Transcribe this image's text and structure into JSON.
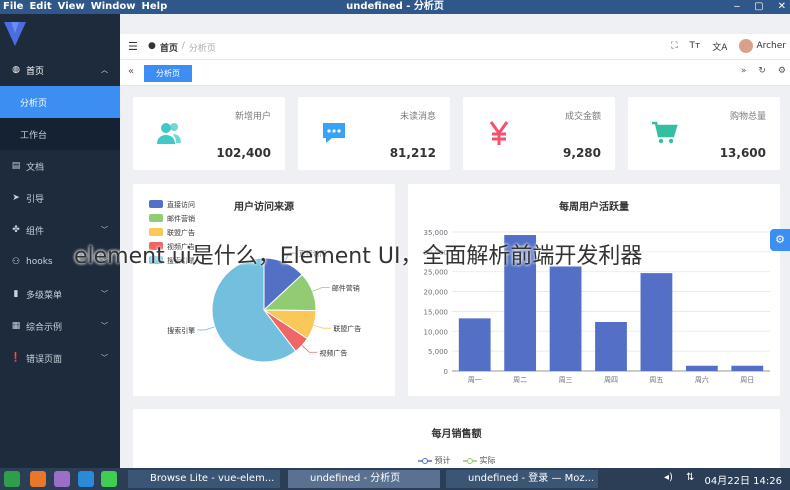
{
  "window": {
    "title": "undefined - 分析页",
    "menus": [
      "File",
      "Edit",
      "View",
      "Window",
      "Help"
    ]
  },
  "sidebar": {
    "items": [
      {
        "label": "首页",
        "icon": "dashboard-icon",
        "expanded": true
      },
      {
        "label": "文档",
        "icon": "document-icon"
      },
      {
        "label": "引导",
        "icon": "send-icon"
      },
      {
        "label": "组件",
        "icon": "component-icon"
      },
      {
        "label": "hooks",
        "icon": "hooks-icon"
      },
      {
        "label": "多级菜单",
        "icon": "chart-icon"
      },
      {
        "label": "综合示例",
        "icon": "book-icon"
      },
      {
        "label": "错误页面",
        "icon": "error-icon"
      }
    ],
    "subitems": [
      "分析页",
      "工作台"
    ]
  },
  "navbar": {
    "breadcrumb_home": "首页",
    "breadcrumb_current": "分析页",
    "user": "Archer"
  },
  "tags": {
    "active": "分析页"
  },
  "stats": [
    {
      "label": "新增用户",
      "value": "102,400",
      "color": "#40c9c6"
    },
    {
      "label": "未读消息",
      "value": "81,212",
      "color": "#36a3f7"
    },
    {
      "label": "成交金额",
      "value": "9,280",
      "color": "#f4516c"
    },
    {
      "label": "购物总量",
      "value": "13,600",
      "color": "#34bfa3"
    }
  ],
  "pie": {
    "title": "用户访问来源",
    "chart_data": {
      "type": "pie",
      "categories": [
        "直接访问",
        "邮件营销",
        "联盟广告",
        "视频广告",
        "搜索引擎"
      ],
      "values": [
        335,
        310,
        234,
        135,
        1548
      ],
      "colors": [
        "#5470c6",
        "#91cc75",
        "#fac858",
        "#ee6666",
        "#73c0de"
      ],
      "slice_labels": [
        "直接访问",
        "邮件营销",
        "联盟广告",
        "视频广告",
        "搜索引擎"
      ]
    }
  },
  "bar": {
    "title": "每周用户活跃量",
    "chart_data": {
      "type": "bar",
      "categories": [
        "周一",
        "周二",
        "周三",
        "周四",
        "周五",
        "周六",
        "周日"
      ],
      "values": [
        13253,
        34235,
        26321,
        12340,
        24643,
        1322,
        1324
      ],
      "ylim": [
        0,
        35000
      ],
      "yticks": [
        "0",
        "5,000",
        "10,000",
        "15,000",
        "20,000",
        "25,000",
        "30,000",
        "35,000"
      ],
      "color": "#5470c6"
    }
  },
  "monthly": {
    "title": "每月销售额",
    "legend": [
      "预计",
      "实际"
    ],
    "colors": [
      "#5470c6",
      "#91cc75"
    ]
  },
  "overlay_text": "element ui是什么，Element UI，全面解析前端开发利器",
  "taskbar": {
    "apps": [
      "Browse Lite - vue-elem...",
      "undefined - 分析页",
      "undefined - 登录 — Moz..."
    ],
    "clock": "04月22日 14:26"
  }
}
